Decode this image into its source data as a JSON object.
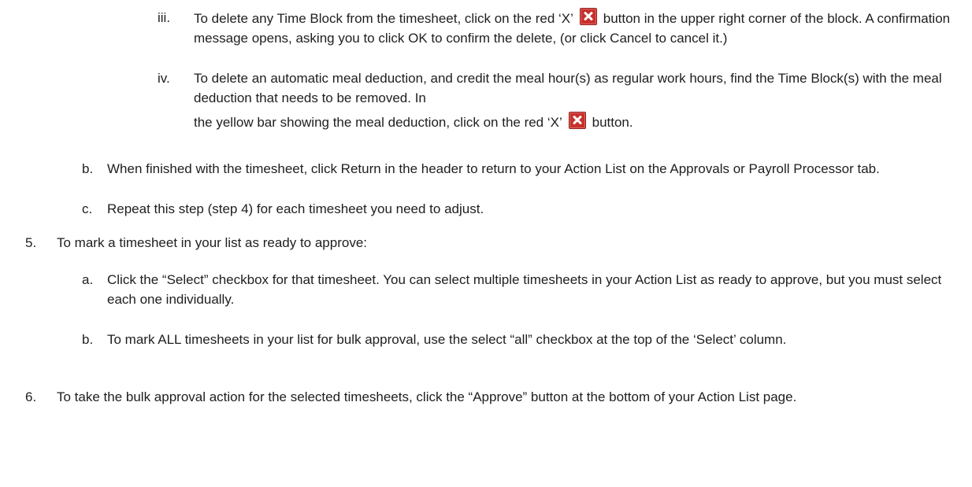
{
  "items": {
    "iii": {
      "marker": "iii.",
      "before_icon": "To delete any Time Block from the timesheet, click on the red ‘X’",
      "after_icon": "button in the upper right corner of the block.  A confirmation message opens, asking you to click OK to confirm the delete, (or click Cancel to cancel it.)"
    },
    "iv": {
      "marker": "iv.",
      "text_main": "To delete an automatic meal deduction, and credit the meal hour(s) as regular work hours, find the Time Block(s) with the meal deduction that needs to be removed.  In",
      "before_icon": "the yellow bar showing the meal deduction, click on the red ‘X’",
      "after_icon": "button."
    },
    "step4b": {
      "marker": "b.",
      "text": "When finished with the timesheet, click Return in the header to return to your Action List on the Approvals or Payroll Processor tab."
    },
    "step4c": {
      "marker": "c.",
      "text": "Repeat this step (step 4) for each timesheet you need to adjust."
    },
    "step5": {
      "marker": "5.",
      "text": "To mark a timesheet in your list as ready to approve:"
    },
    "step5a": {
      "marker": "a.",
      "text": "Click the “Select” checkbox for that timesheet.  You can select multiple timesheets in your Action List as ready to approve, but you must select each one individually."
    },
    "step5b": {
      "marker": "b.",
      "text": "To mark ALL timesheets in your list for bulk approval, use the select “all” checkbox at the top of the ‘Select’ column."
    },
    "step6": {
      "marker": "6.",
      "text": "To take the bulk approval action for the selected timesheets, click the “Approve” button at the bottom of your Action List page."
    }
  },
  "icons": {
    "delete": "red-x-delete-icon",
    "delete_color": "#c9302c"
  }
}
